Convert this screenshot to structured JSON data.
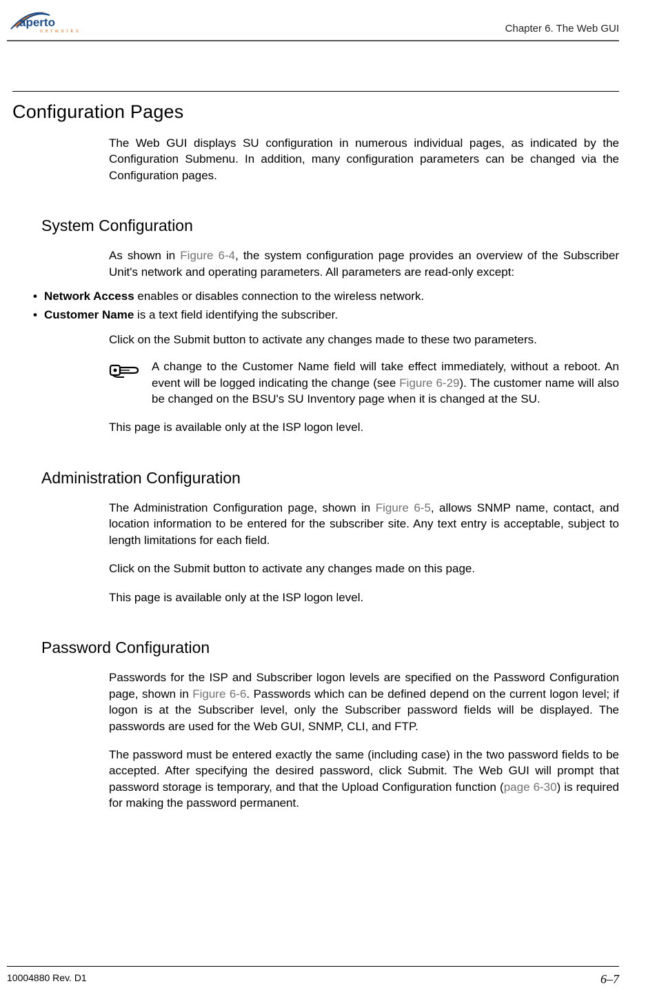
{
  "header": {
    "chapter": "Chapter 6.  The Web GUI"
  },
  "h1": "Configuration Pages",
  "intro": "The Web GUI displays SU configuration in numerous individual pages, as indicated by the Configuration Submenu. In addition, many configuration parameters can be changed via the Configuration pages.",
  "sysconf": {
    "heading": "System Configuration",
    "p1_a": "As shown in ",
    "p1_fig": "Figure 6-4",
    "p1_b": ", the system configuration page provides an overview of the Subscriber Unit's network and operating parameters. All parameters are read-only except:",
    "bul1_bold": "Network Access",
    "bul1_rest": " enables or disables connection to the wireless network.",
    "bul2_bold": "Customer Name",
    "bul2_rest": " is a text field identifying the subscriber.",
    "p2": "Click on the Submit button to activate any changes made to these two parameters.",
    "note_a": "A change to the Customer Name field will take effect immediately, without a reboot. An event will be logged indicating the change (see ",
    "note_fig": "Figure 6-29",
    "note_b": "). The customer name will also be changed on the BSU's SU Inventory page when it is changed at the SU.",
    "p3": "This page is available only at the ISP logon level."
  },
  "adminconf": {
    "heading": "Administration Configuration",
    "p1_a": "The Administration Configuration page, shown in ",
    "p1_fig": "Figure 6-5",
    "p1_b": ", allows SNMP name, contact, and location information to be entered for the subscriber site. Any text entry is acceptable, subject to length limitations for each field.",
    "p2": "Click on the Submit button to activate any changes made on this page.",
    "p3": "This page is available only at the ISP logon level."
  },
  "pwdconf": {
    "heading": "Password Configuration",
    "p1_a": "Passwords for the ISP and Subscriber logon levels are specified on the Password Configuration page, shown in ",
    "p1_fig": "Figure 6-6",
    "p1_b": ". Passwords which can be defined depend on the current logon level; if logon is at the Subscriber level, only the Subscriber password fields will be displayed. The passwords are used for the Web GUI, SNMP, CLI, and FTP.",
    "p2_a": "The password must be entered exactly the same (including case) in the two password fields to be accepted. After specifying the desired password, click Submit. The Web GUI will prompt that password storage is temporary, and that the Upload Configuration function (",
    "p2_ref": "page 6-30",
    "p2_b": ") is required for making the password permanent."
  },
  "footer": {
    "left": "10004880 Rev. D1",
    "right": "6–7"
  }
}
